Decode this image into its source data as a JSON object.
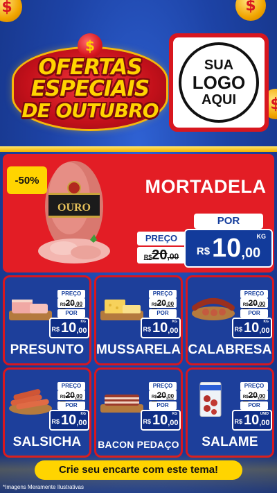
{
  "header": {
    "title_lines": [
      "OFERTAS",
      "ESPECIAIS",
      "DE OUTUBRO"
    ],
    "coin_symbol": "$",
    "logo": {
      "line1": "SUA",
      "line2": "LOGO",
      "line3": "AQUI"
    }
  },
  "featured": {
    "discount": "-50%",
    "name": "MORTADELA",
    "brand_label": "OURO",
    "preco_label": "PREÇO",
    "old_price": {
      "currency": "R$",
      "int": "20",
      "dec": ",00"
    },
    "por_label": "POR",
    "new_price": {
      "currency": "R$",
      "int": "10",
      "dec": ",00",
      "unit": "KG"
    }
  },
  "products": [
    {
      "name": "PRESUNTO",
      "preco_label": "PREÇO",
      "old_price": {
        "currency": "R$",
        "int": "20",
        "dec": ",00"
      },
      "por_label": "POR",
      "new_price": {
        "currency": "R$",
        "int": "10",
        "dec": ",00",
        "unit": "KG"
      }
    },
    {
      "name": "MUSSARELA",
      "preco_label": "PREÇO",
      "old_price": {
        "currency": "R$",
        "int": "20",
        "dec": ",00"
      },
      "por_label": "POR",
      "new_price": {
        "currency": "R$",
        "int": "10",
        "dec": ",00",
        "unit": "KG"
      }
    },
    {
      "name": "CALABRESA",
      "preco_label": "PREÇO",
      "old_price": {
        "currency": "R$",
        "int": "20",
        "dec": ",00"
      },
      "por_label": "POR",
      "new_price": {
        "currency": "R$",
        "int": "10",
        "dec": ",00",
        "unit": "KG"
      }
    },
    {
      "name": "SALSICHA",
      "preco_label": "PREÇO",
      "old_price": {
        "currency": "R$",
        "int": "20",
        "dec": ",00"
      },
      "por_label": "POR",
      "new_price": {
        "currency": "R$",
        "int": "10",
        "dec": ",00",
        "unit": "KG"
      }
    },
    {
      "name": "BACON PEDAÇO",
      "preco_label": "PREÇO",
      "old_price": {
        "currency": "R$",
        "int": "20",
        "dec": ",00"
      },
      "por_label": "POR",
      "new_price": {
        "currency": "R$",
        "int": "10",
        "dec": ",00",
        "unit": "KG"
      }
    },
    {
      "name": "SALAME",
      "preco_label": "PREÇO",
      "old_price": {
        "currency": "R$",
        "int": "20",
        "dec": ",00"
      },
      "por_label": "POR",
      "new_price": {
        "currency": "R$",
        "int": "10",
        "dec": ",00",
        "unit": "UNID"
      }
    }
  ],
  "footer": {
    "cta": "Crie seu encarte com este tema!",
    "disclaimer": "*Imagens Meramente Ilustrativas"
  },
  "colors": {
    "brand_red": "#e31d25",
    "brand_blue": "#1d3f9b",
    "brand_yellow": "#ffd400"
  }
}
